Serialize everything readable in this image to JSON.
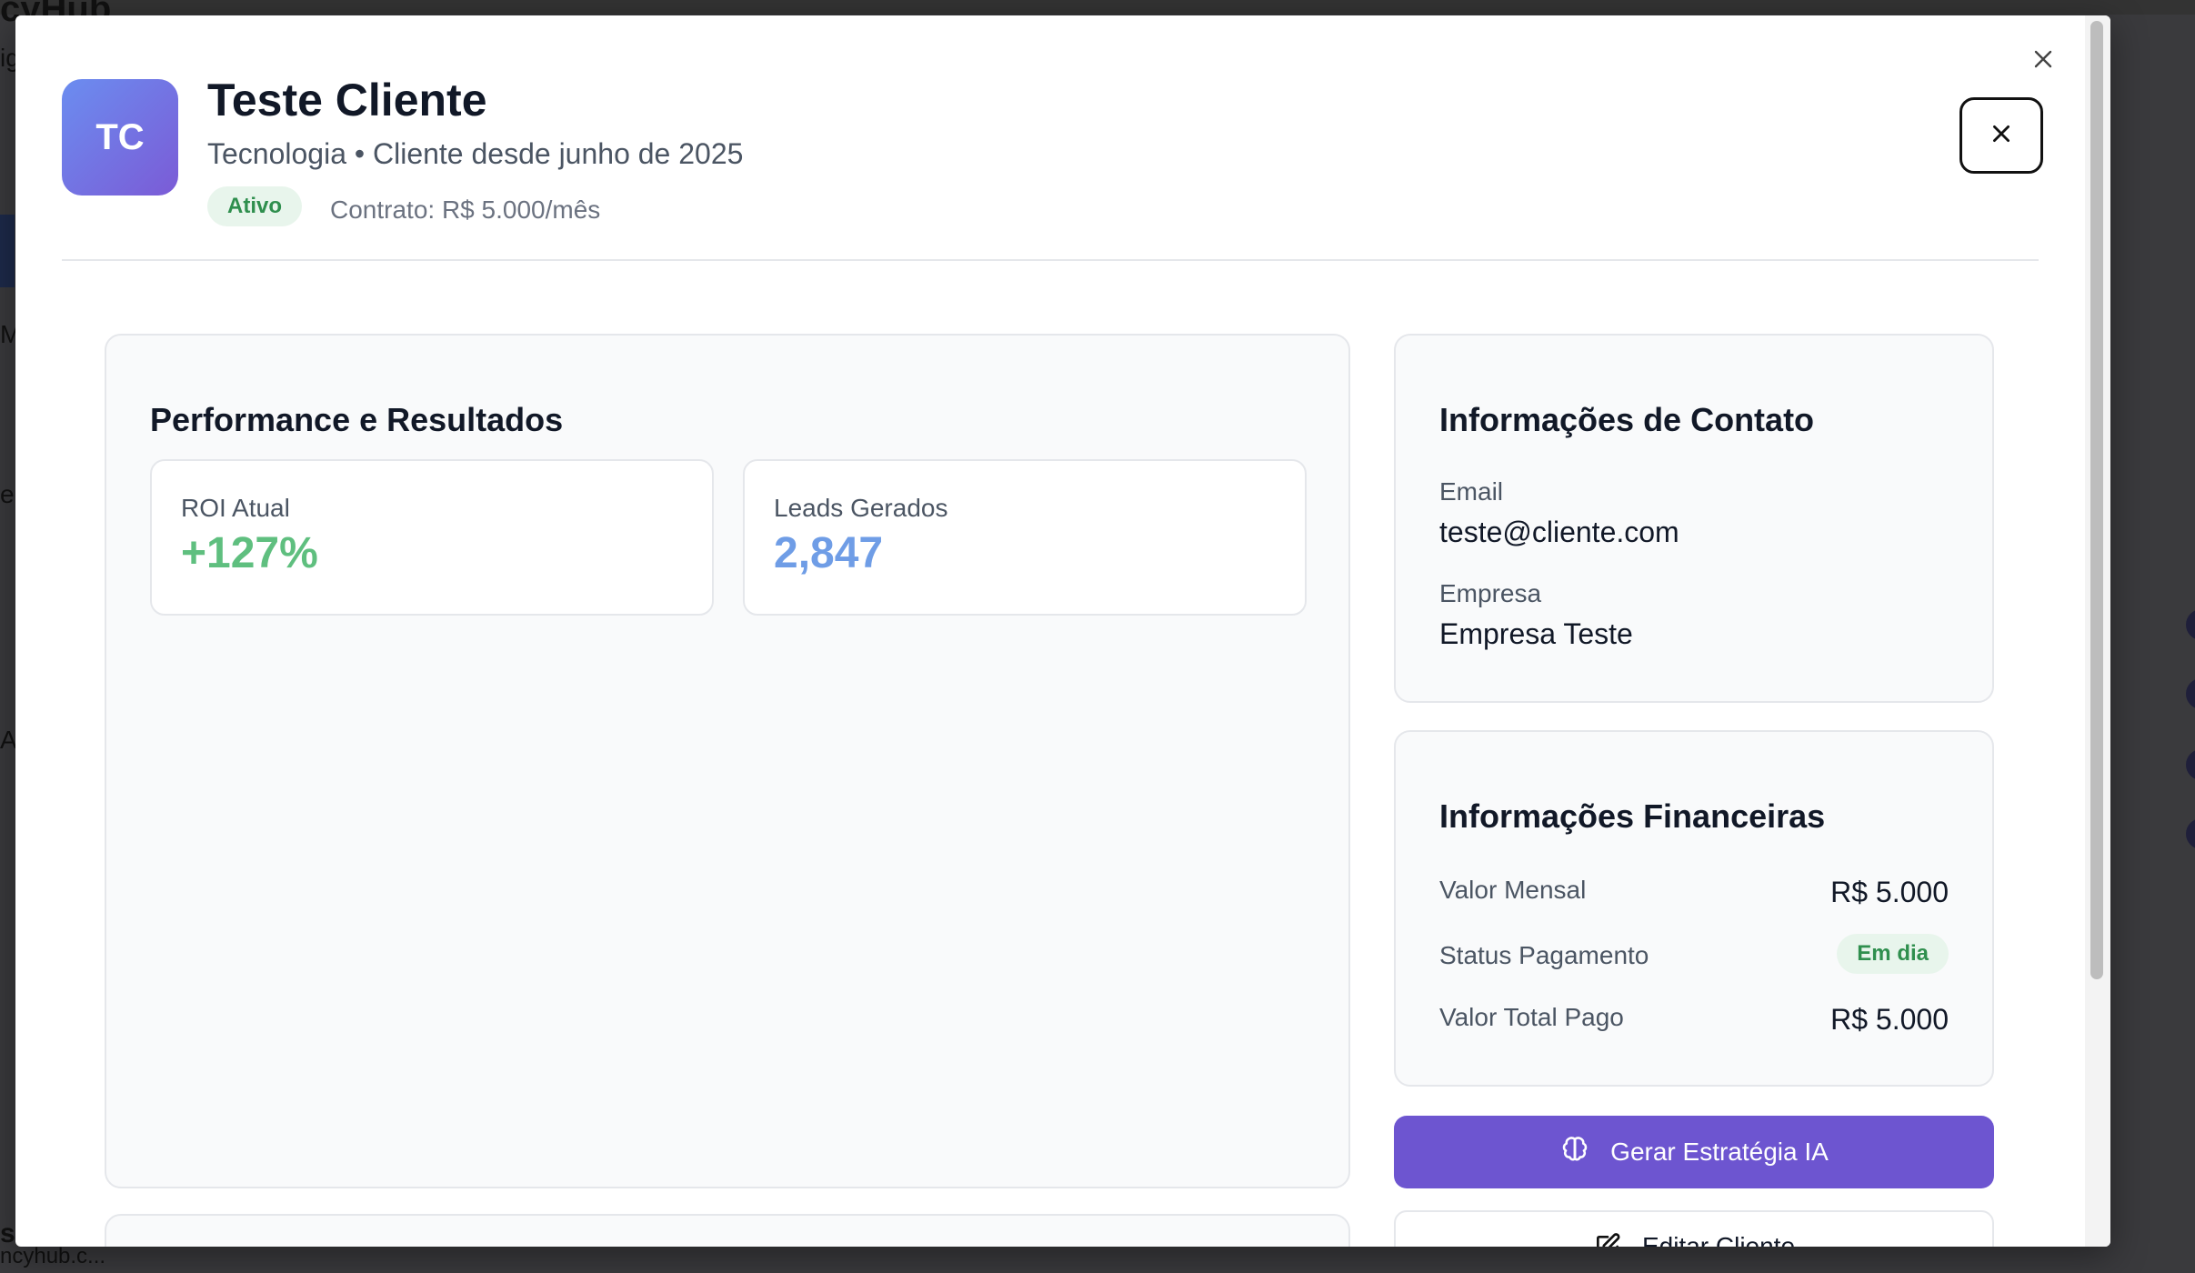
{
  "background": {
    "fragments": [
      "cyHub",
      "ig",
      "M",
      "e",
      "A",
      "s",
      "ncyhub.c..."
    ]
  },
  "modal": {
    "avatar_initials": "TC",
    "client_name": "Teste Cliente",
    "client_subtitle": "Tecnologia • Cliente desde junho de 2025",
    "status_badge": "Ativo",
    "contract": "Contrato: R$ 5.000/mês",
    "close_icon": "close-icon"
  },
  "performance": {
    "title": "Performance e Resultados",
    "stats": [
      {
        "label": "ROI Atual",
        "value": "+127%",
        "color": "#5fbf7f"
      },
      {
        "label": "Leads Gerados",
        "value": "2,847",
        "color": "#6f9de6"
      }
    ]
  },
  "contact": {
    "title": "Informações de Contato",
    "fields": [
      {
        "label": "Email",
        "value": "teste@cliente.com"
      },
      {
        "label": "Empresa",
        "value": "Empresa Teste"
      }
    ]
  },
  "financial": {
    "title": "Informações Financeiras",
    "rows": [
      {
        "label": "Valor Mensal",
        "value": "R$ 5.000"
      },
      {
        "label": "Status Pagamento",
        "badge": "Em dia"
      },
      {
        "label": "Valor Total Pago",
        "value": "R$ 5.000"
      }
    ]
  },
  "actions": {
    "generate_strategy": "Gerar Estratégia IA",
    "edit_client": "Editar Cliente"
  },
  "colors": {
    "accent": "#6d55d0",
    "success": "#2f8f4e",
    "success_bg": "#e8f5ec"
  }
}
